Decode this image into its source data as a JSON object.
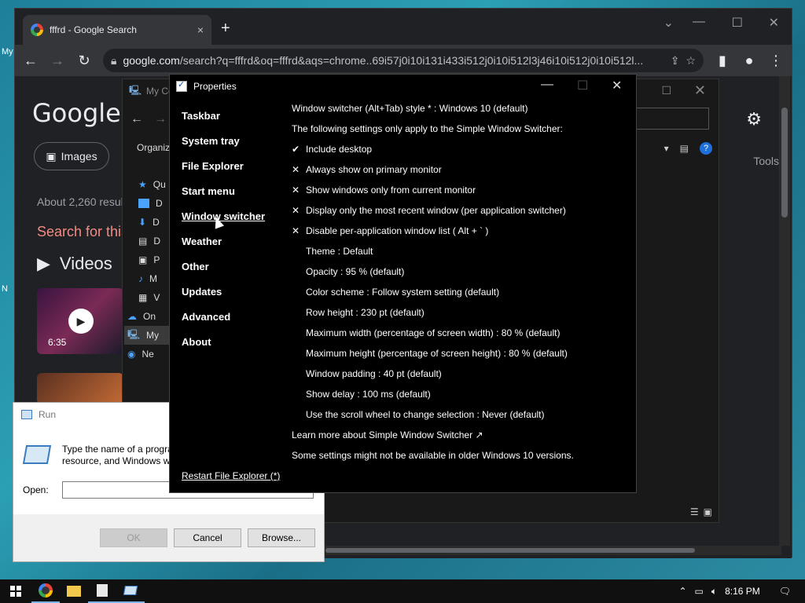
{
  "desktop": {
    "left_frag_1": "My",
    "left_frag_2": "N"
  },
  "chrome": {
    "tab_title": "fffrd - Google Search",
    "tab_close": "×",
    "new_tab": "+",
    "url_host": "google.com",
    "url_path": "/search?q=fffrd&oq=fffrd&aqs=chrome..69i57j0i10i131i433i512j0i10i512l3j46i10i512j0i10i512l...",
    "google_logo": "Google",
    "images_chip": "Images",
    "results_count": "About 2,260 resul",
    "search_for": "Search for this",
    "videos_heading": "Videos",
    "video_duration": "6:35",
    "tools": "Tools"
  },
  "explorer": {
    "title": "My Co",
    "organize": "Organiz",
    "tree": [
      {
        "label": "Qu",
        "icon": "star-icon"
      },
      {
        "label": "D",
        "icon": "desktop-icon"
      },
      {
        "label": "D",
        "icon": "download-icon"
      },
      {
        "label": "D",
        "icon": "documents-icon"
      },
      {
        "label": "P",
        "icon": "pictures-icon"
      },
      {
        "label": "M",
        "icon": "music-icon"
      },
      {
        "label": "V",
        "icon": "videos-icon"
      },
      {
        "label": "On",
        "icon": "onedrive-icon"
      },
      {
        "label": "My",
        "icon": "this-pc-icon"
      },
      {
        "label": "Ne",
        "icon": "network-icon"
      }
    ]
  },
  "run": {
    "title": "Run",
    "description": "Type the name of a progra resource, and Windows wi",
    "open_label": "Open:",
    "open_value": "",
    "ok_label": "OK",
    "cancel_label": "Cancel",
    "browse_label": "Browse..."
  },
  "properties": {
    "title": "Properties",
    "nav": [
      {
        "label": "Taskbar",
        "active": false
      },
      {
        "label": "System tray",
        "active": false
      },
      {
        "label": "File Explorer",
        "active": false
      },
      {
        "label": "Start menu",
        "active": false
      },
      {
        "label": "Window switcher",
        "active": true
      },
      {
        "label": "Weather",
        "active": false
      },
      {
        "label": "Other",
        "active": false
      },
      {
        "label": "Updates",
        "active": false
      },
      {
        "label": "Advanced",
        "active": false
      },
      {
        "label": "About",
        "active": false
      }
    ],
    "restart_link": "Restart File Explorer (*)",
    "settings": [
      {
        "mark": "",
        "text": "Window switcher (Alt+Tab) style * : Windows 10 (default)",
        "indent": false
      },
      {
        "mark": "",
        "text": "The following settings only apply to the Simple Window Switcher:",
        "indent": false
      },
      {
        "mark": "✔",
        "text": "Include desktop",
        "indent": false
      },
      {
        "mark": "✕",
        "text": "Always show on primary monitor",
        "indent": false
      },
      {
        "mark": "✕",
        "text": "Show windows only from current monitor",
        "indent": false
      },
      {
        "mark": "✕",
        "text": "Display only the most recent window (per application switcher)",
        "indent": false
      },
      {
        "mark": "✕",
        "text": "Disable per-application window list ( Alt + ` )",
        "indent": false
      },
      {
        "mark": "",
        "text": "Theme : Default",
        "indent": true
      },
      {
        "mark": "",
        "text": "Opacity : 95 % (default)",
        "indent": true
      },
      {
        "mark": "",
        "text": "Color scheme : Follow system setting (default)",
        "indent": true
      },
      {
        "mark": "",
        "text": "Row height : 230 pt (default)",
        "indent": true
      },
      {
        "mark": "",
        "text": "Maximum width (percentage of screen width) : 80 % (default)",
        "indent": true
      },
      {
        "mark": "",
        "text": "Maximum height (percentage of screen height) : 80 % (default)",
        "indent": true
      },
      {
        "mark": "",
        "text": "Window padding : 40 pt (default)",
        "indent": true
      },
      {
        "mark": "",
        "text": "Show delay : 100 ms (default)",
        "indent": true
      },
      {
        "mark": "",
        "text": "Use the scroll wheel to change selection : Never (default)",
        "indent": true
      },
      {
        "mark": "",
        "text": "Learn more about Simple Window Switcher ↗",
        "indent": false
      },
      {
        "mark": "",
        "text": "Some settings might not be available in older Windows 10 versions.",
        "indent": false
      }
    ]
  },
  "taskbar": {
    "time": "8:16 PM"
  }
}
